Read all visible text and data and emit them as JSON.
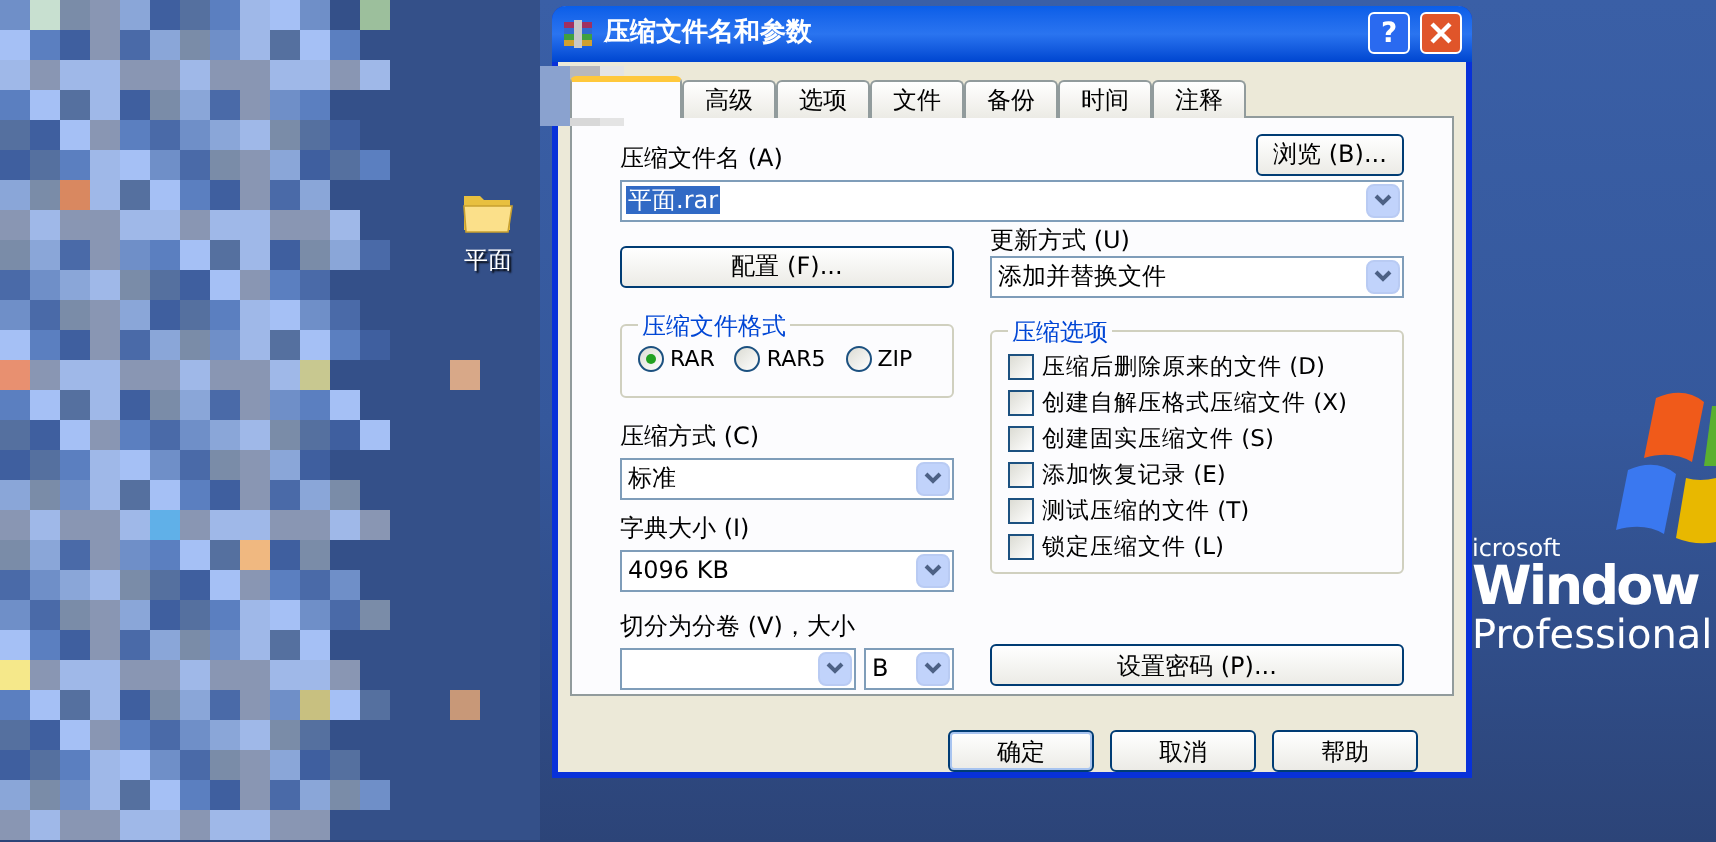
{
  "desktop": {
    "icons": [
      {
        "label": "平面"
      }
    ],
    "wallpaper_text": [
      "icrosoft",
      "Window",
      "Professional"
    ]
  },
  "window": {
    "title": "压缩文件名和参数",
    "help_button": "?"
  },
  "tabs": [
    {
      "selected": true
    },
    {
      "label": "高级",
      "selected": false
    },
    {
      "label": "选项",
      "selected": false
    },
    {
      "label": "文件",
      "selected": false
    },
    {
      "label": "备份",
      "selected": false
    },
    {
      "label": "时间",
      "selected": false
    },
    {
      "label": "注释",
      "selected": false
    }
  ],
  "archive_name": {
    "label": "压缩文件名 (A)",
    "browse_button": "浏览 (B)...",
    "value": "平面.rar",
    "value_selected": true
  },
  "profiles_button": "配置 (F)...",
  "update_mode": {
    "label": "更新方式 (U)",
    "value": "添加并替换文件"
  },
  "format": {
    "title": "压缩文件格式",
    "options": [
      {
        "label": "RAR",
        "selected": true
      },
      {
        "label": "RAR5",
        "selected": false
      },
      {
        "label": "ZIP",
        "selected": false
      }
    ]
  },
  "method": {
    "label": "压缩方式 (C)",
    "value": "标准"
  },
  "dictionary": {
    "label": "字典大小 (I)",
    "value": "4096 KB"
  },
  "split": {
    "label": "切分为分卷 (V)，大小",
    "unit": "B"
  },
  "options": {
    "title": "压缩选项",
    "items": [
      {
        "label": "压缩后删除原来的文件 (D)",
        "checked": false
      },
      {
        "label": "创建自解压格式压缩文件 (X)",
        "checked": false
      },
      {
        "label": "创建固实压缩文件 (S)",
        "checked": false
      },
      {
        "label": "添加恢复记录 (E)",
        "checked": false
      },
      {
        "label": "测试压缩的文件 (T)",
        "checked": false
      },
      {
        "label": "锁定压缩文件 (L)",
        "checked": false
      }
    ]
  },
  "password_button": "设置密码 (P)...",
  "buttons": [
    {
      "label": "确定",
      "default": true
    },
    {
      "label": "取消",
      "default": false
    },
    {
      "label": "帮助",
      "default": false
    }
  ]
}
